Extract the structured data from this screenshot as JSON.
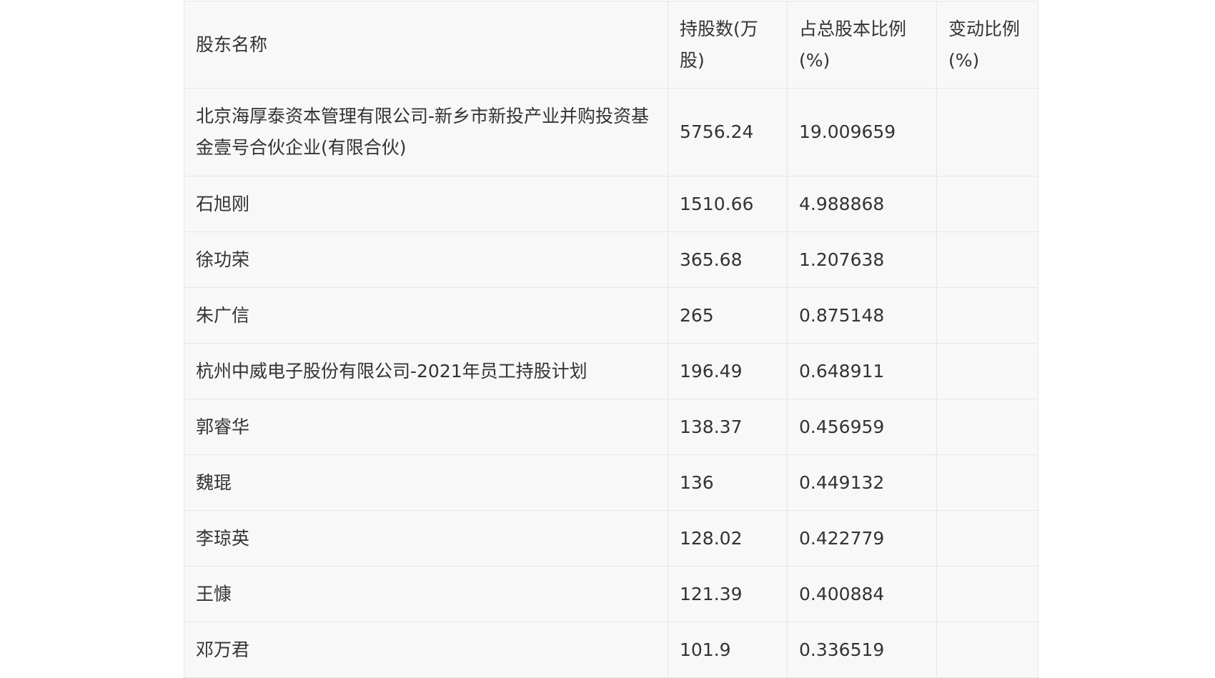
{
  "table": {
    "headers": [
      "股东名称",
      "持股数(万股)",
      "占总股本比例(%)",
      "变动比例(%)"
    ],
    "rows": [
      {
        "name": "北京海厚泰资本管理有限公司-新乡市新投产业并购投资基金壹号合伙企业(有限合伙)",
        "shares": "5756.24",
        "ratio": "19.009659",
        "change": ""
      },
      {
        "name": "石旭刚",
        "shares": "1510.66",
        "ratio": "4.988868",
        "change": ""
      },
      {
        "name": "徐功荣",
        "shares": "365.68",
        "ratio": "1.207638",
        "change": ""
      },
      {
        "name": "朱广信",
        "shares": "265",
        "ratio": "0.875148",
        "change": ""
      },
      {
        "name": "杭州中威电子股份有限公司-2021年员工持股计划",
        "shares": "196.49",
        "ratio": "0.648911",
        "change": ""
      },
      {
        "name": "郭睿华",
        "shares": "138.37",
        "ratio": "0.456959",
        "change": ""
      },
      {
        "name": "魏琨",
        "shares": "136",
        "ratio": "0.449132",
        "change": ""
      },
      {
        "name": "李琼英",
        "shares": "128.02",
        "ratio": "0.422779",
        "change": ""
      },
      {
        "name": "王慷",
        "shares": "121.39",
        "ratio": "0.400884",
        "change": ""
      },
      {
        "name": "邓万君",
        "shares": "101.9",
        "ratio": "0.336519",
        "change": ""
      }
    ]
  }
}
